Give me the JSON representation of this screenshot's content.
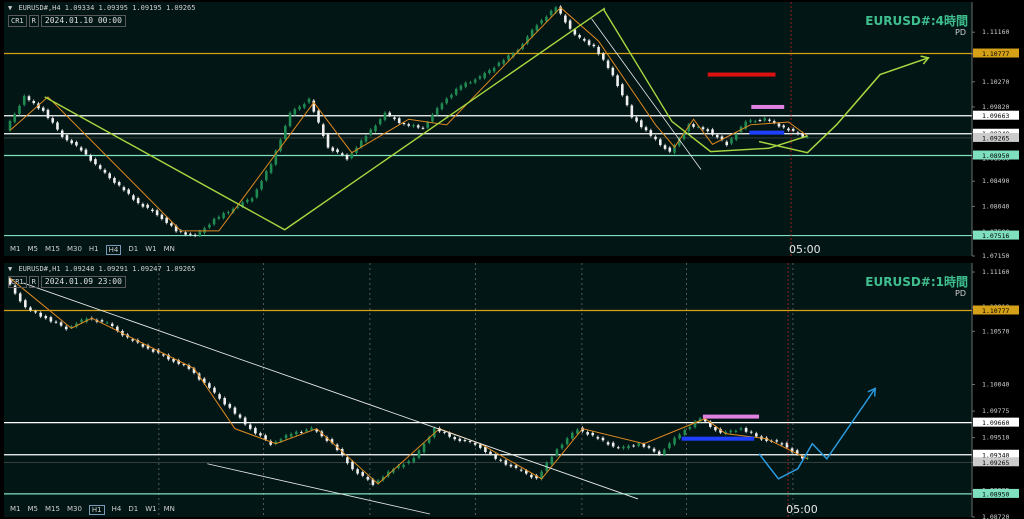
{
  "timeframes": [
    "M1",
    "M5",
    "M15",
    "M30",
    "H1",
    "H4",
    "D1",
    "W1",
    "MN"
  ],
  "chart_data": [
    {
      "type": "candlestick",
      "symbol_header": "EURUSD#,H4  1.09334 1.09395 1.09195 1.09265",
      "date_label": "2024.01.10 00:00",
      "button_cr": "CR1",
      "button_r": "R",
      "title": "EURUSD#:4時間",
      "subtitle": "PD",
      "active_timeframe": "H4",
      "time_marker": "05:00",
      "ylim": [
        1.0715,
        1.117
      ],
      "y_ticks": [
        1.1116,
        1.1077,
        1.1027,
        1.0982,
        1.0937,
        1.089,
        1.0849,
        1.0804,
        1.0758,
        1.0715
      ],
      "y_tick_labels": [
        "1.11160",
        "1.10770",
        "1.10270",
        "1.09820",
        "1.09370",
        "1.08900",
        "1.08490",
        "1.08040",
        "1.07580",
        "1.07150"
      ],
      "levels": [
        {
          "value": 1.10777,
          "label": "1.10777",
          "color": "#d4a017",
          "label_bg": "#d4a017"
        },
        {
          "value": 1.09663,
          "label": "1.09663",
          "color": "#ffffff",
          "label_bg": "#ffffff"
        },
        {
          "value": 1.0934,
          "label": "1.09340",
          "color": "#ffffff",
          "label_bg": "#ffffff"
        },
        {
          "value": 1.09265,
          "label": "1.09265",
          "color": "#555555",
          "label_bg": "#cccccc"
        },
        {
          "value": 1.0895,
          "label": "1.08950",
          "color": "#7fe0c0",
          "label_bg": "#7fe0c0"
        },
        {
          "value": 1.07516,
          "label": "1.07516",
          "color": "#7fe0c0",
          "label_bg": "#7fe0c0"
        }
      ],
      "path": [
        1.094,
        1.1,
        1.0975,
        1.093,
        1.0905,
        1.087,
        1.084,
        1.081,
        1.079,
        1.076,
        1.075,
        1.078,
        1.08,
        1.082,
        1.088,
        1.097,
        1.0995,
        1.091,
        1.089,
        1.093,
        1.097,
        1.095,
        1.0945,
        1.099,
        1.102,
        1.1035,
        1.106,
        1.1085,
        1.113,
        1.116,
        1.111,
        1.109,
        1.104,
        1.0965,
        1.093,
        1.09,
        1.095,
        1.094,
        1.0915,
        1.0955,
        1.096,
        1.0945,
        1.093
      ],
      "zigzag": [
        [
          0,
          1.094
        ],
        [
          2,
          1.1
        ],
        [
          9,
          1.076
        ],
        [
          11,
          1.076
        ],
        [
          16,
          1.099
        ],
        [
          18,
          1.09
        ],
        [
          21,
          1.096
        ],
        [
          23,
          1.095
        ],
        [
          29,
          1.116
        ],
        [
          31,
          1.11
        ],
        [
          34,
          1.095
        ],
        [
          35,
          1.091
        ],
        [
          36,
          1.096
        ],
        [
          37,
          1.0915
        ],
        [
          39,
          1.095
        ],
        [
          41,
          1.0955
        ],
        [
          42,
          1.093
        ]
      ],
      "trend_line": [
        [
          1.0,
          1.1
        ],
        [
          0.5,
          1.0762
        ],
        [
          1.11,
          1.1158
        ],
        [
          0.96,
          1.1155
        ],
        [
          1.2,
          1.0956
        ],
        [
          1.5,
          1.0902
        ],
        [
          1.65,
          1.0908
        ],
        [
          1.8,
          1.093
        ]
      ],
      "channel_line": [
        [
          0.607,
          1.114
        ],
        [
          0.72,
          1.087
        ]
      ],
      "projection": [
        [
          0.78,
          1.092
        ],
        [
          0.83,
          1.09
        ],
        [
          0.86,
          1.095
        ],
        [
          0.905,
          1.104
        ],
        [
          0.955,
          1.107
        ]
      ],
      "markers": [
        {
          "x0": 0.727,
          "x1": 0.797,
          "value": 1.104,
          "color": "#dd1111"
        },
        {
          "x0": 0.772,
          "x1": 0.806,
          "value": 1.0982,
          "color": "#e080e0"
        },
        {
          "x0": 0.77,
          "x1": 0.806,
          "value": 1.0936,
          "color": "#1f3fff"
        }
      ],
      "vgrid": [],
      "cursor_x": 0.813
    },
    {
      "type": "candlestick",
      "symbol_header": "EURUSD#,H1  1.09248 1.09291 1.09247 1.09265",
      "date_label": "2024.01.09 23:00",
      "button_cr": "CR1",
      "button_r": "R",
      "title": "EURUSD#:1時間",
      "subtitle": "PD",
      "active_timeframe": "H1",
      "time_marker": "05:00",
      "ylim": [
        1.0872,
        1.1125
      ],
      "y_ticks": [
        1.1116,
        1.1081,
        1.1057,
        1.1004,
        1.09775,
        1.0951,
        1.09265,
        1.08985,
        1.0872
      ],
      "y_tick_labels": [
        "1.11160",
        "1.10810",
        "1.10570",
        "1.10040",
        "1.09775",
        "1.09510",
        "1.09265",
        "1.08985",
        "1.08720"
      ],
      "levels": [
        {
          "value": 1.10777,
          "label": "1.10777",
          "color": "#d4a017",
          "label_bg": "#d4a017"
        },
        {
          "value": 1.0966,
          "label": "1.09660",
          "color": "#ffffff",
          "label_bg": "#ffffff"
        },
        {
          "value": 1.0934,
          "label": "1.09340",
          "color": "#ffffff",
          "label_bg": "#ffffff"
        },
        {
          "value": 1.09265,
          "label": "1.09265",
          "color": "#555555",
          "label_bg": "#cccccc"
        },
        {
          "value": 1.0895,
          "label": "1.08950",
          "color": "#7fe0c0",
          "label_bg": "#7fe0c0"
        }
      ],
      "path": [
        1.111,
        1.108,
        1.107,
        1.106,
        1.107,
        1.1065,
        1.105,
        1.104,
        1.103,
        1.102,
        1.1,
        1.098,
        1.096,
        1.0945,
        1.0955,
        1.096,
        1.0945,
        1.092,
        1.0905,
        1.092,
        1.093,
        1.096,
        1.095,
        1.0945,
        1.093,
        1.092,
        1.091,
        1.094,
        1.096,
        1.095,
        1.094,
        1.0945,
        1.0935,
        1.0955,
        1.097,
        1.0955,
        1.096,
        1.095,
        1.0945,
        1.093
      ],
      "zigzag": [
        [
          0,
          1.111
        ],
        [
          3,
          1.106
        ],
        [
          4,
          1.107
        ],
        [
          9,
          1.102
        ],
        [
          11,
          1.096
        ],
        [
          13,
          1.0945
        ],
        [
          15,
          1.096
        ],
        [
          18,
          1.0905
        ],
        [
          21,
          1.096
        ],
        [
          23,
          1.0945
        ],
        [
          26,
          1.091
        ],
        [
          28,
          1.096
        ],
        [
          31,
          1.0945
        ],
        [
          34,
          1.097
        ],
        [
          35,
          1.0955
        ],
        [
          37,
          1.095
        ],
        [
          39,
          1.093
        ]
      ],
      "trend_line": [
        [
          1.02,
          1.1105
        ],
        [
          0.655,
          1.089
        ]
      ],
      "channel_line": [
        [
          0.21,
          1.0925
        ],
        [
          0.44,
          1.0875
        ]
      ],
      "projection": [
        [
          0.78,
          1.0935
        ],
        [
          0.8,
          1.091
        ],
        [
          0.82,
          1.092
        ],
        [
          0.835,
          1.0945
        ],
        [
          0.85,
          1.093
        ],
        [
          0.9,
          1.1
        ]
      ],
      "markers": [
        {
          "x0": 0.722,
          "x1": 0.78,
          "value": 1.0972,
          "color": "#e080e0"
        },
        {
          "x0": 0.7,
          "x1": 0.775,
          "value": 1.095,
          "color": "#1f3fff"
        }
      ],
      "vgrid": [
        0.16,
        0.268,
        0.378,
        0.487,
        0.597,
        0.705,
        0.815
      ],
      "cursor_x": 0.81
    }
  ]
}
